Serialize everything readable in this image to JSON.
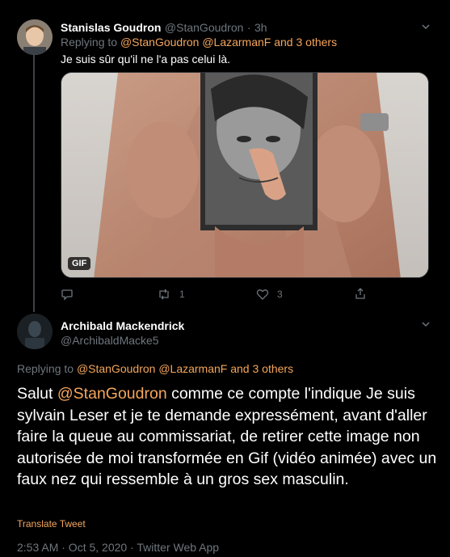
{
  "reply": {
    "name": "Stanislas Goudron",
    "handle": "@StanGoudron",
    "dot": "·",
    "time": "3h",
    "replying_prefix": "Replying to",
    "replying_to": "@StanGoudron @LazarmanF and 3 others",
    "text": "Je suis sûr qu'il ne l'a pas celui là.",
    "gif_label": "GIF",
    "retweet_count": "1",
    "like_count": "3"
  },
  "main": {
    "name": "Archibald Mackendrick",
    "handle": "@ArchibaldMacke5",
    "replying_prefix": "Replying to",
    "replying_to": "@StanGoudron @LazarmanF and 3 others",
    "text_mention": "@StanGoudron",
    "text_before": "Salut ",
    "text_after": " comme ce compte l'indique Je suis sylvain Leser et je te demande expressément, avant d'aller faire la queue au commissariat, de retirer cette image non autorisée de moi transformée en Gif (vidéo animée) avec un faux nez qui ressemble à un gros sex masculin.",
    "translate": "Translate Tweet",
    "meta": "2:53 AM · Oct 5, 2020 · Twitter Web App"
  },
  "colors": {
    "background": "#000000",
    "link": "#f5a65b",
    "muted": "#6e767d"
  }
}
